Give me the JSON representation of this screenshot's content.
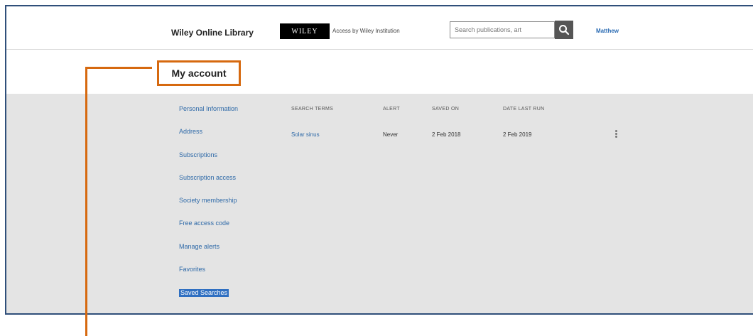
{
  "header": {
    "brand": "Wiley Online Library",
    "logo_text": "WILEY",
    "access_text": "Access by Wiley Institution",
    "search_placeholder": "Search publications, art",
    "user_name": "Matthew"
  },
  "page": {
    "title": "My account"
  },
  "sidebar": {
    "items": [
      {
        "label": "Personal Information"
      },
      {
        "label": "Address"
      },
      {
        "label": "Subscriptions"
      },
      {
        "label": "Subscription access"
      },
      {
        "label": "Society membership"
      },
      {
        "label": "Free access code"
      },
      {
        "label": "Manage alerts"
      },
      {
        "label": "Favorites"
      },
      {
        "label": "Saved Searches"
      }
    ],
    "active_index": 8
  },
  "saved_searches": {
    "columns": [
      "SEARCH TERMS",
      "ALERT",
      "SAVED ON",
      "DATE LAST RUN"
    ],
    "rows": [
      {
        "term": "Solar sinus",
        "alert": "Never",
        "saved_on": "2 Feb 2018",
        "last_run": "2 Feb 2019"
      }
    ]
  },
  "colors": {
    "accent": "#d6690f",
    "link": "#2f6aa8",
    "active": "#2f6fc1"
  },
  "icons": {
    "search": "search-icon",
    "row_menu": "more-vertical-icon"
  }
}
